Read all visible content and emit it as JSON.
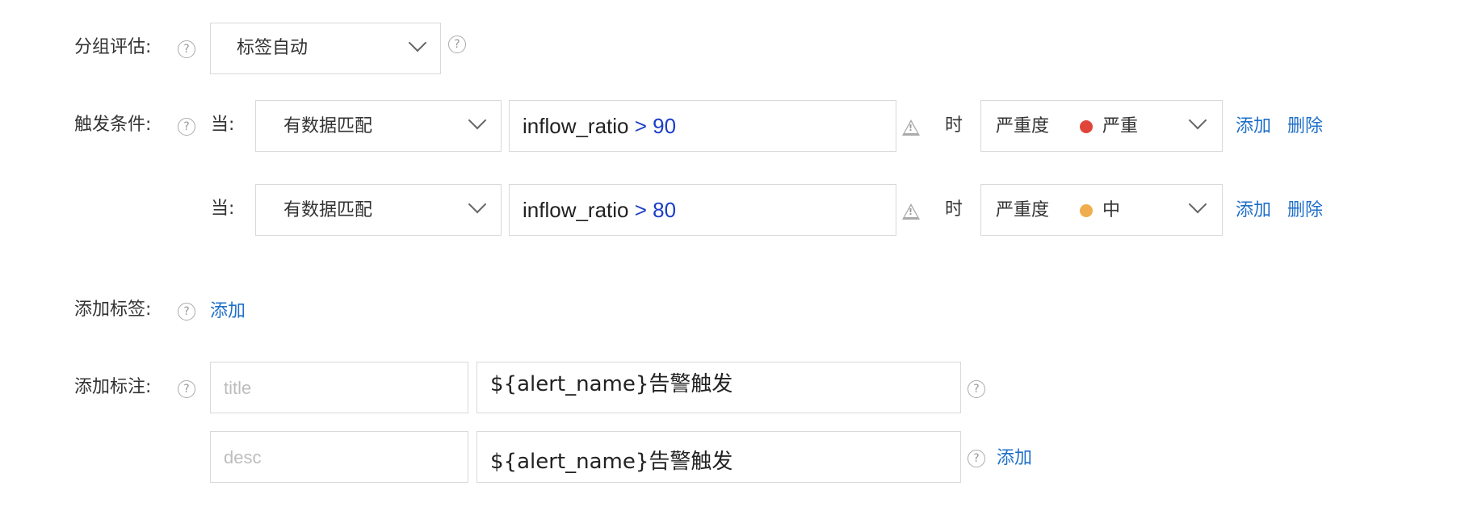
{
  "group_eval": {
    "label": "分组评估:",
    "select_value": "标签自动"
  },
  "trigger": {
    "label": "触发条件:",
    "rows": [
      {
        "when": "当:",
        "match": "有数据匹配",
        "expr_field": "inflow_ratio",
        "expr_op": " > 90",
        "at": "时",
        "severity_label": "严重度",
        "severity_value": "严重",
        "severity_color": "#e0453a",
        "add": "添加",
        "delete": "删除"
      },
      {
        "when": "当:",
        "match": "有数据匹配",
        "expr_field": "inflow_ratio",
        "expr_op": " > 80",
        "at": "时",
        "severity_label": "严重度",
        "severity_value": "中",
        "severity_color": "#f0ad4e",
        "add": "添加",
        "delete": "删除"
      }
    ]
  },
  "tags": {
    "label": "添加标签:",
    "add": "添加"
  },
  "annotations": {
    "label": "添加标注:",
    "rows": [
      {
        "key_placeholder": "title",
        "value": "${alert_name}告警触发"
      },
      {
        "key_placeholder": "desc",
        "value": "${alert_name}告警触发"
      }
    ],
    "add": "添加"
  },
  "icons": {
    "help": "question-circle-icon",
    "warning": "warning-triangle-icon",
    "chevron": "chevron-down-icon"
  }
}
